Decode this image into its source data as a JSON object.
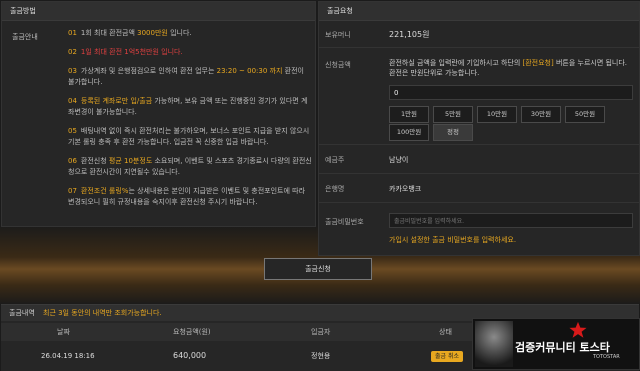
{
  "left": {
    "title": "출금방법",
    "label": "출금안내",
    "notices": [
      {
        "num": "01",
        "a": "1회 최대 환전금액 ",
        "b": "3000만원",
        "c": " 입니다."
      },
      {
        "num": "02",
        "a": "",
        "b": "1일 최대 환전 1억5천만원 입니다.",
        "c": ""
      },
      {
        "num": "03",
        "a": "가상계좌 및 은행점검으로 인하여 환전 업무는 ",
        "b": "23:20 ~ 00:30 까지",
        "c": " 환전이 불가합니다."
      },
      {
        "num": "04",
        "a": "",
        "b": "등록된 계좌로만 입/출금",
        "c": " 가능하며, 보유 금액 또는 진행중인 경기가 있다면 계좌변경이 불가능합니다."
      },
      {
        "num": "05",
        "a": "배팅내역 없이 즉시 환전처리는 불가하오며, 보너스 포인트 지급을 받지 않으시 기본 롤링 충족 후 환전 가능합니다. 입금전 꼭 신중한 입금 바랍니다.",
        "b": "",
        "c": ""
      },
      {
        "num": "06",
        "a": "환전신청 ",
        "b": "평균 10분정도",
        "c": " 소요되며, 이벤트 및 스포츠 경기종료시 다량의 환전신청으로 환전시간이 지연될수 있습니다."
      },
      {
        "num": "07",
        "a": "",
        "b": "환전조건 롤링%",
        "c": "는 상세내용은 본인이 지급받은 이벤트 및 충전포인트에 따라 변경되오니 필히 규정내용을 숙지이후 환전신청 주시기 바랍니다."
      }
    ]
  },
  "right": {
    "title": "출금요청",
    "balance_label": "보유머니",
    "balance_value": "221,105원",
    "amount_label": "신청금액",
    "amount_help_a": "환전하실 금액을 입력란에 기입하시고 하단의 ",
    "amount_help_b": "[환전요청]",
    "amount_help_c": " 버튼을 누르시면 됩니다. 환전은 만원단위로 가능합니다.",
    "amount_value": "0",
    "buttons": [
      "1만원",
      "5만원",
      "10만원",
      "30만원",
      "50만원",
      "100만원",
      "정정"
    ],
    "holder_label": "예금주",
    "holder_value": "남냥이",
    "bank_label": "은행명",
    "bank_value": "카카오뱅크",
    "pw_label": "출금비밀번호",
    "pw_placeholder": "출금비밀번호를 입력하세요.",
    "pw_note": "가입시 설정한 출금 비밀번호를 입력하세요."
  },
  "submit_label": "출금신청",
  "history": {
    "title": "출금내역",
    "subtitle": "최근 3일 동안의 내역만 조회가능합니다.",
    "columns": [
      "날짜",
      "요청금액(원)",
      "입금자",
      "상태"
    ],
    "rows": [
      {
        "date": "26.04.19 18:16",
        "amount": "640,000",
        "name": "정현용",
        "status": "출금 취소"
      }
    ]
  },
  "promo": {
    "text": "검증커뮤니티 토스타",
    "sub": "TOTOSTAR"
  }
}
